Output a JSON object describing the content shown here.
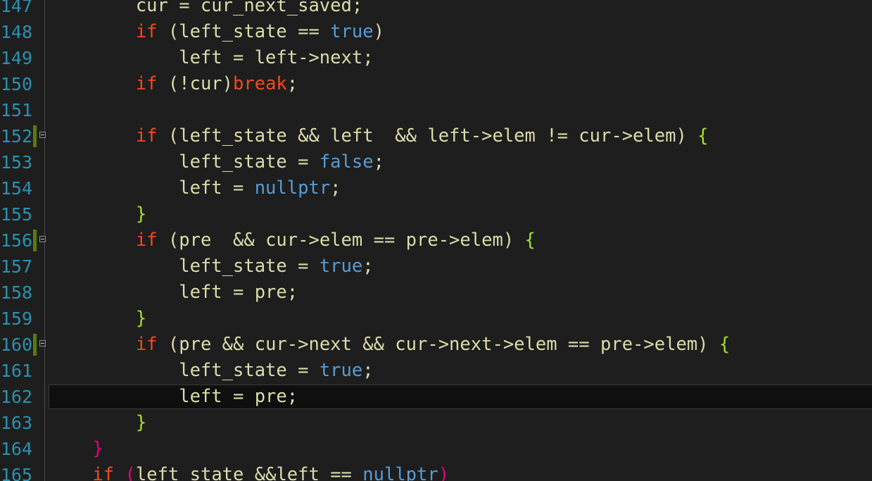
{
  "editor": {
    "colors": {
      "background": "#1e1e1e",
      "line_number": "#2b91af",
      "keyword_control": "#f44a1c",
      "keyword_literal": "#569cd6",
      "identifier": "#dcdcaa",
      "brace": "#a8e02a",
      "brace_outer": "#e5007e",
      "modified_bar": "#587c0c"
    },
    "current_line_number": "162",
    "lines": [
      {
        "n": "147",
        "fold": false,
        "mod": false,
        "tokens": [
          {
            "t": "        cur = cur_next_saved;",
            "c": "#dcdcaa"
          }
        ]
      },
      {
        "n": "148",
        "fold": false,
        "mod": false,
        "tokens": [
          {
            "t": "        ",
            "c": "#dcdcaa"
          },
          {
            "t": "if",
            "c": "#f44a1c"
          },
          {
            "t": " (left_state == ",
            "c": "#dcdcaa"
          },
          {
            "t": "true",
            "c": "#569cd6"
          },
          {
            "t": ")",
            "c": "#dcdcaa"
          }
        ]
      },
      {
        "n": "149",
        "fold": false,
        "mod": false,
        "tokens": [
          {
            "t": "            left = left->next;",
            "c": "#dcdcaa"
          }
        ]
      },
      {
        "n": "150",
        "fold": false,
        "mod": false,
        "tokens": [
          {
            "t": "        ",
            "c": "#dcdcaa"
          },
          {
            "t": "if",
            "c": "#f44a1c"
          },
          {
            "t": " (!cur)",
            "c": "#dcdcaa"
          },
          {
            "t": "break",
            "c": "#f44a1c"
          },
          {
            "t": ";",
            "c": "#dcdcaa"
          }
        ]
      },
      {
        "n": "151",
        "fold": false,
        "mod": false,
        "tokens": []
      },
      {
        "n": "152",
        "fold": true,
        "mod": true,
        "tokens": [
          {
            "t": "        ",
            "c": "#dcdcaa"
          },
          {
            "t": "if",
            "c": "#f44a1c"
          },
          {
            "t": " (left_state && left  && left->elem != cur->elem) ",
            "c": "#dcdcaa"
          },
          {
            "t": "{",
            "c": "#a8e02a"
          }
        ]
      },
      {
        "n": "153",
        "fold": false,
        "mod": false,
        "tokens": [
          {
            "t": "            left_state = ",
            "c": "#dcdcaa"
          },
          {
            "t": "false",
            "c": "#569cd6"
          },
          {
            "t": ";",
            "c": "#dcdcaa"
          }
        ]
      },
      {
        "n": "154",
        "fold": false,
        "mod": false,
        "tokens": [
          {
            "t": "            left = ",
            "c": "#dcdcaa"
          },
          {
            "t": "nullptr",
            "c": "#569cd6"
          },
          {
            "t": ";",
            "c": "#dcdcaa"
          }
        ]
      },
      {
        "n": "155",
        "fold": false,
        "mod": false,
        "tokens": [
          {
            "t": "        ",
            "c": "#dcdcaa"
          },
          {
            "t": "}",
            "c": "#a8e02a"
          }
        ]
      },
      {
        "n": "156",
        "fold": true,
        "mod": true,
        "tokens": [
          {
            "t": "        ",
            "c": "#dcdcaa"
          },
          {
            "t": "if",
            "c": "#f44a1c"
          },
          {
            "t": " (pre  && cur->elem == pre->elem) ",
            "c": "#dcdcaa"
          },
          {
            "t": "{",
            "c": "#a8e02a"
          }
        ]
      },
      {
        "n": "157",
        "fold": false,
        "mod": false,
        "tokens": [
          {
            "t": "            left_state = ",
            "c": "#dcdcaa"
          },
          {
            "t": "true",
            "c": "#569cd6"
          },
          {
            "t": ";",
            "c": "#dcdcaa"
          }
        ]
      },
      {
        "n": "158",
        "fold": false,
        "mod": false,
        "tokens": [
          {
            "t": "            left = pre;",
            "c": "#dcdcaa"
          }
        ]
      },
      {
        "n": "159",
        "fold": false,
        "mod": false,
        "tokens": [
          {
            "t": "        ",
            "c": "#dcdcaa"
          },
          {
            "t": "}",
            "c": "#a8e02a"
          }
        ]
      },
      {
        "n": "160",
        "fold": true,
        "mod": true,
        "tokens": [
          {
            "t": "        ",
            "c": "#dcdcaa"
          },
          {
            "t": "if",
            "c": "#f44a1c"
          },
          {
            "t": " (pre && cur->next && cur->next->elem == pre->elem) ",
            "c": "#dcdcaa"
          },
          {
            "t": "{",
            "c": "#a8e02a"
          }
        ]
      },
      {
        "n": "161",
        "fold": false,
        "mod": false,
        "tokens": [
          {
            "t": "            left_state = ",
            "c": "#dcdcaa"
          },
          {
            "t": "true",
            "c": "#569cd6"
          },
          {
            "t": ";",
            "c": "#dcdcaa"
          }
        ]
      },
      {
        "n": "162",
        "fold": false,
        "mod": false,
        "tokens": [
          {
            "t": "            left = pre;",
            "c": "#dcdcaa"
          }
        ]
      },
      {
        "n": "163",
        "fold": false,
        "mod": false,
        "tokens": [
          {
            "t": "        ",
            "c": "#dcdcaa"
          },
          {
            "t": "}",
            "c": "#a8e02a"
          }
        ]
      },
      {
        "n": "164",
        "fold": false,
        "mod": false,
        "tokens": [
          {
            "t": "    ",
            "c": "#dcdcaa"
          },
          {
            "t": "}",
            "c": "#e5007e"
          }
        ]
      },
      {
        "n": "165",
        "fold": false,
        "mod": false,
        "tokens": [
          {
            "t": "    ",
            "c": "#dcdcaa"
          },
          {
            "t": "if",
            "c": "#f44a1c"
          },
          {
            "t": " ",
            "c": "#dcdcaa"
          },
          {
            "t": "(",
            "c": "#e5007e"
          },
          {
            "t": "left_state &&left == ",
            "c": "#dcdcaa"
          },
          {
            "t": "nullptr",
            "c": "#569cd6"
          },
          {
            "t": ")",
            "c": "#e5007e"
          }
        ]
      }
    ]
  }
}
